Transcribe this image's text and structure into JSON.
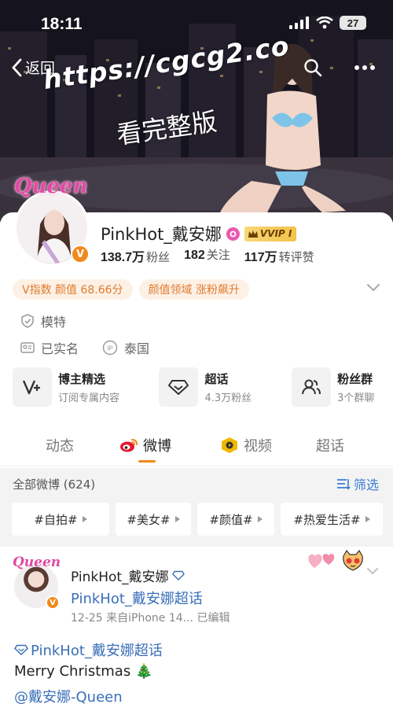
{
  "status_bar": {
    "time": "18:11",
    "battery": "27"
  },
  "hero": {
    "back_label": "返回",
    "watermark_url": "https://cgcg2.co",
    "watermark_text": "看完整版"
  },
  "profile": {
    "queen_tag": "Queen",
    "name": "PinkHot_戴安娜",
    "vvip_label": "VVIP I",
    "stats": [
      {
        "value": "138.7万",
        "label": "粉丝"
      },
      {
        "value": "182",
        "label": "关注"
      },
      {
        "value": "117万",
        "label": "转评赞"
      }
    ],
    "tags": [
      "V指数 颜值 68.66分",
      "颜值领域 涨粉飙升"
    ],
    "occupation": "模特",
    "verification": "已实名",
    "location": "泰国"
  },
  "entries": [
    {
      "title": "博主精选",
      "subtitle": "订阅专属内容",
      "icon": "v-plus-icon"
    },
    {
      "title": "超话",
      "subtitle": "4.3万粉丝",
      "icon": "diamond-icon"
    },
    {
      "title": "粉丝群",
      "subtitle": "3个群聊",
      "icon": "group-icon"
    }
  ],
  "tabs": [
    "动态",
    "微博",
    "视频",
    "超话"
  ],
  "filter": {
    "all_count": "全部微博 (624)",
    "filter_label": "筛选",
    "chips": [
      "#自拍#",
      "#美女#",
      "#颜值#",
      "#热爱生活#"
    ]
  },
  "post": {
    "queen_tag": "Queen",
    "author": "PinkHot_戴安娜",
    "topic": "PinkHot_戴安娜超话",
    "meta": "12-25  来自iPhone 14...  已编辑",
    "line1": "PinkHot_戴安娜超话",
    "line2": "Merry Christmas 🎄",
    "line3": "@戴安娜-Queen"
  },
  "colors": {
    "accent": "#f08a1c",
    "link": "#3a6fb8",
    "pill_bg": "#fdf1e6",
    "pill_text": "#e07a2c"
  }
}
